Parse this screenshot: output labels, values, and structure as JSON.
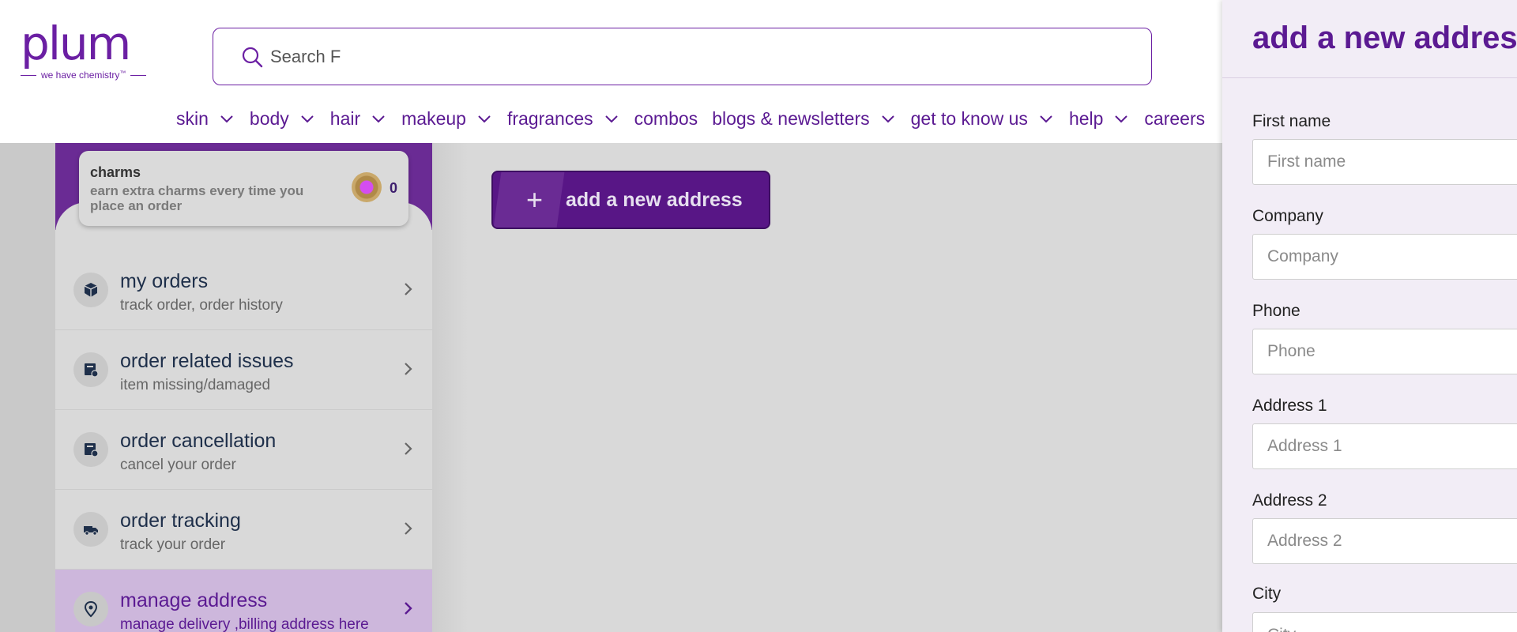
{
  "header": {
    "logo_text": "plum",
    "logo_tagline": "we have chemistry",
    "logo_tm": "™",
    "search_placeholder": "Search F"
  },
  "nav": [
    {
      "label": "skin",
      "has_dropdown": true
    },
    {
      "label": "body",
      "has_dropdown": true
    },
    {
      "label": "hair",
      "has_dropdown": true
    },
    {
      "label": "makeup",
      "has_dropdown": true
    },
    {
      "label": "fragrances",
      "has_dropdown": true
    },
    {
      "label": "combos",
      "has_dropdown": false
    },
    {
      "label": "blogs & newsletters",
      "has_dropdown": true
    },
    {
      "label": "get to know us",
      "has_dropdown": true
    },
    {
      "label": "help",
      "has_dropdown": true
    },
    {
      "label": "careers",
      "has_dropdown": false
    }
  ],
  "charms": {
    "title": "charms",
    "subtitle": "earn extra charms every time you place an order",
    "count": "0"
  },
  "menu": [
    {
      "title": "my orders",
      "sub": "track order, order history",
      "icon": "box-icon",
      "active": false
    },
    {
      "title": "order related issues",
      "sub": "item missing/damaged",
      "icon": "issue-icon",
      "active": false
    },
    {
      "title": "order cancellation",
      "sub": "cancel your order",
      "icon": "cancel-icon",
      "active": false
    },
    {
      "title": "order tracking",
      "sub": "track your order",
      "icon": "truck-icon",
      "active": false
    },
    {
      "title": "manage address",
      "sub": "manage delivery ,billing address here",
      "icon": "location-pin-icon",
      "active": true
    }
  ],
  "main": {
    "add_address_label": "add a new address",
    "add_address_plus": "+"
  },
  "drawer": {
    "title": "add a new address",
    "fields": [
      {
        "label": "First name",
        "placeholder": "First name"
      },
      {
        "label": "Company",
        "placeholder": "Company"
      },
      {
        "label": "Phone",
        "placeholder": "Phone"
      },
      {
        "label": "Address 1",
        "placeholder": "Address 1"
      },
      {
        "label": "Address 2",
        "placeholder": "Address 2"
      },
      {
        "label": "City",
        "placeholder": "City"
      }
    ]
  },
  "colors": {
    "brand_purple": "#5b1a92",
    "active_menu_bg": "#cdb7dc",
    "drawer_bg": "#f2edf6"
  }
}
